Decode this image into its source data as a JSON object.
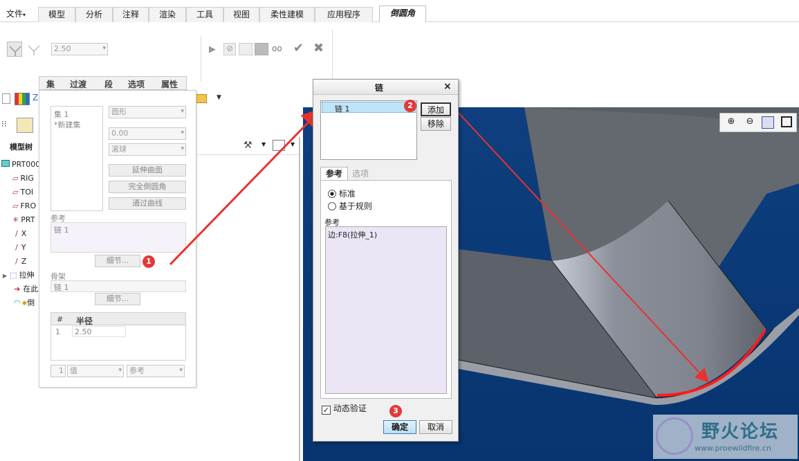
{
  "menu": {
    "file": "文件",
    "tabs": [
      "模型",
      "分析",
      "注释",
      "渲染",
      "工具",
      "视图",
      "柔性建模",
      "应用程序"
    ],
    "active_tab": "倒圆角"
  },
  "ribbon": {
    "radius_value": "2.50",
    "panel_tabs": [
      "集",
      "过渡",
      "段",
      "选项",
      "属性"
    ]
  },
  "model_tree": {
    "title": "模型树",
    "items": [
      "PRT000",
      "RIG",
      "TOI",
      "FRO",
      "PRT",
      "X",
      "Y",
      "Z",
      "拉伸",
      "在此",
      "倒"
    ]
  },
  "set_panel": {
    "set_item": "集 1",
    "new_set": "*新建集",
    "shape": "圆形",
    "value": "0.00",
    "method": "滚球",
    "btn_extend": "延伸曲面",
    "btn_full": "完全倒圆角",
    "btn_curve": "通过曲线",
    "ref_label": "参考",
    "ref_value": "链 1",
    "details_btn": "细节...",
    "skeleton_label": "骨架",
    "skeleton_value": "链 1",
    "details_btn2": "细节...",
    "table_header_num": "#",
    "table_header_radius": "半径",
    "table_row_num": "1",
    "table_row_radius": "2.50",
    "footer_num": "1",
    "footer_value": "值",
    "footer_ref": "参考"
  },
  "dialog": {
    "title": "链",
    "close": "×",
    "list_item": "链 1",
    "add_btn": "添加",
    "remove_btn": "移除",
    "tab_ref": "参考",
    "tab_opts": "选项",
    "radio_standard": "标准",
    "radio_rule": "基于规则",
    "ref_label": "参考",
    "ref_text": "边:F8(拉伸_1)",
    "dynamic_check": "动态验证",
    "ok": "确定",
    "cancel": "取消"
  },
  "badges": [
    "1",
    "2",
    "3"
  ],
  "watermark": {
    "title": "野火论坛",
    "url": "www.proewildfire.cn"
  },
  "colors": {
    "accent_red": "#e03a3a",
    "selection_blue": "#bfe3f7",
    "viewport_blue": "#0b3a78"
  }
}
